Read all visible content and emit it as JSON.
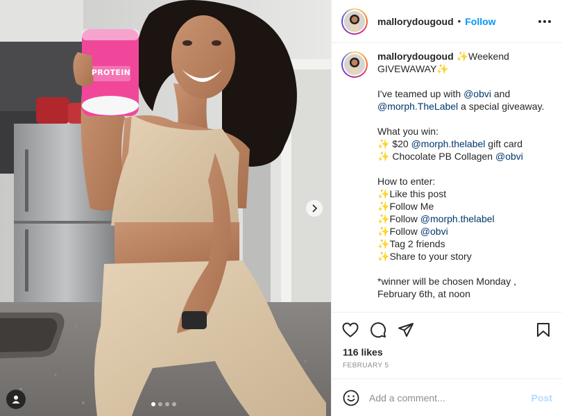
{
  "post": {
    "username": "mallorydougoud",
    "separator": "•",
    "follow_label": "Follow",
    "likes": "116 likes",
    "date": "FEBRUARY 5",
    "carousel": {
      "slides": 4,
      "active": 1
    }
  },
  "caption": {
    "username": "mallorydougoud",
    "lines": [
      [
        {
          "t": " ✨",
          "cls": "sparkle"
        },
        {
          "t": "Weekend GIVEWAWAY"
        },
        {
          "t": "✨",
          "cls": "sparkle"
        }
      ],
      [],
      [
        {
          "t": "I've teamed up with "
        },
        {
          "t": "@obvi",
          "cls": "mention"
        },
        {
          "t": " and "
        },
        {
          "t": "@morph.TheLabel",
          "cls": "mention"
        },
        {
          "t": " a special giveaway."
        }
      ],
      [],
      [
        {
          "t": "What you win:"
        }
      ],
      [
        {
          "t": "✨",
          "cls": "sparkle"
        },
        {
          "t": " $20 "
        },
        {
          "t": "@morph.thelabel",
          "cls": "mention"
        },
        {
          "t": " gift card"
        }
      ],
      [
        {
          "t": "✨",
          "cls": "sparkle"
        },
        {
          "t": " Chocolate PB Collagen "
        },
        {
          "t": "@obvi",
          "cls": "mention"
        }
      ],
      [],
      [
        {
          "t": "How to enter:"
        }
      ],
      [
        {
          "t": "✨",
          "cls": "sparkle"
        },
        {
          "t": "Like this post"
        }
      ],
      [
        {
          "t": "✨",
          "cls": "sparkle"
        },
        {
          "t": "Follow Me"
        }
      ],
      [
        {
          "t": "✨",
          "cls": "sparkle"
        },
        {
          "t": "Follow "
        },
        {
          "t": "@morph.thelabel",
          "cls": "mention"
        }
      ],
      [
        {
          "t": "✨",
          "cls": "sparkle"
        },
        {
          "t": "Follow "
        },
        {
          "t": "@obvi",
          "cls": "mention"
        }
      ],
      [
        {
          "t": "✨",
          "cls": "sparkle"
        },
        {
          "t": "Tag 2 friends"
        }
      ],
      [
        {
          "t": "✨",
          "cls": "sparkle"
        },
        {
          "t": "Share to your story"
        }
      ],
      [],
      [
        {
          "t": "*winner will be chosen Monday , February 6th, at noon"
        }
      ]
    ]
  },
  "comment": {
    "placeholder": "Add a comment...",
    "post_label": "Post"
  },
  "product": {
    "label": "PROTEIN"
  },
  "icons": {
    "like": "heart-icon",
    "comment": "comment-icon",
    "share": "paper-plane-icon",
    "save": "bookmark-icon",
    "emoji": "smiley-icon",
    "tag": "person-icon",
    "next": "chevron-right-icon",
    "more": "more-horizontal-icon"
  },
  "colors": {
    "accent": "#0095f6",
    "mention": "#00376b",
    "post_disabled": "#b3dbff",
    "muted": "#8e8e8e"
  }
}
